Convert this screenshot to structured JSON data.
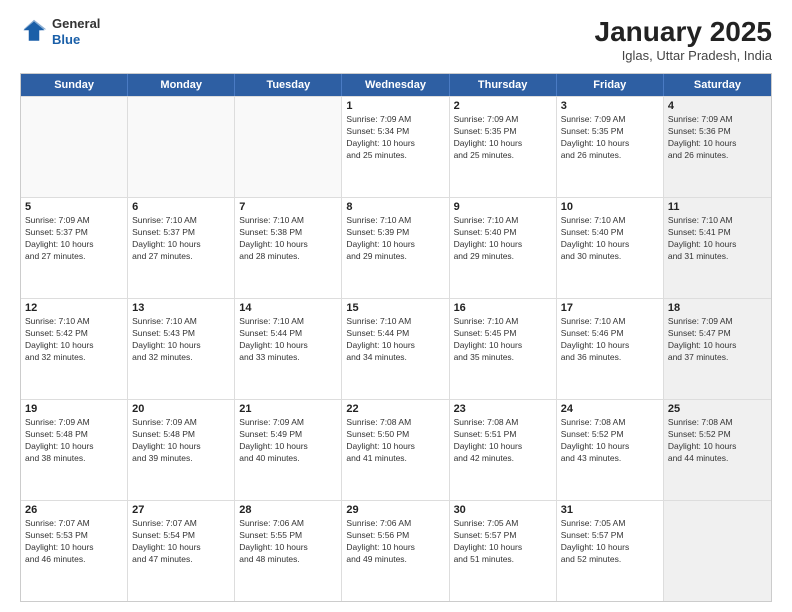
{
  "logo": {
    "general": "General",
    "blue": "Blue"
  },
  "title": "January 2025",
  "subtitle": "Iglas, Uttar Pradesh, India",
  "header_days": [
    "Sunday",
    "Monday",
    "Tuesday",
    "Wednesday",
    "Thursday",
    "Friday",
    "Saturday"
  ],
  "weeks": [
    [
      {
        "day": "",
        "info": "",
        "empty": true
      },
      {
        "day": "",
        "info": "",
        "empty": true
      },
      {
        "day": "",
        "info": "",
        "empty": true
      },
      {
        "day": "1",
        "info": "Sunrise: 7:09 AM\nSunset: 5:34 PM\nDaylight: 10 hours\nand 25 minutes."
      },
      {
        "day": "2",
        "info": "Sunrise: 7:09 AM\nSunset: 5:35 PM\nDaylight: 10 hours\nand 25 minutes."
      },
      {
        "day": "3",
        "info": "Sunrise: 7:09 AM\nSunset: 5:35 PM\nDaylight: 10 hours\nand 26 minutes."
      },
      {
        "day": "4",
        "info": "Sunrise: 7:09 AM\nSunset: 5:36 PM\nDaylight: 10 hours\nand 26 minutes.",
        "shaded": true
      }
    ],
    [
      {
        "day": "5",
        "info": "Sunrise: 7:09 AM\nSunset: 5:37 PM\nDaylight: 10 hours\nand 27 minutes."
      },
      {
        "day": "6",
        "info": "Sunrise: 7:10 AM\nSunset: 5:37 PM\nDaylight: 10 hours\nand 27 minutes."
      },
      {
        "day": "7",
        "info": "Sunrise: 7:10 AM\nSunset: 5:38 PM\nDaylight: 10 hours\nand 28 minutes."
      },
      {
        "day": "8",
        "info": "Sunrise: 7:10 AM\nSunset: 5:39 PM\nDaylight: 10 hours\nand 29 minutes."
      },
      {
        "day": "9",
        "info": "Sunrise: 7:10 AM\nSunset: 5:40 PM\nDaylight: 10 hours\nand 29 minutes."
      },
      {
        "day": "10",
        "info": "Sunrise: 7:10 AM\nSunset: 5:40 PM\nDaylight: 10 hours\nand 30 minutes."
      },
      {
        "day": "11",
        "info": "Sunrise: 7:10 AM\nSunset: 5:41 PM\nDaylight: 10 hours\nand 31 minutes.",
        "shaded": true
      }
    ],
    [
      {
        "day": "12",
        "info": "Sunrise: 7:10 AM\nSunset: 5:42 PM\nDaylight: 10 hours\nand 32 minutes."
      },
      {
        "day": "13",
        "info": "Sunrise: 7:10 AM\nSunset: 5:43 PM\nDaylight: 10 hours\nand 32 minutes."
      },
      {
        "day": "14",
        "info": "Sunrise: 7:10 AM\nSunset: 5:44 PM\nDaylight: 10 hours\nand 33 minutes."
      },
      {
        "day": "15",
        "info": "Sunrise: 7:10 AM\nSunset: 5:44 PM\nDaylight: 10 hours\nand 34 minutes."
      },
      {
        "day": "16",
        "info": "Sunrise: 7:10 AM\nSunset: 5:45 PM\nDaylight: 10 hours\nand 35 minutes."
      },
      {
        "day": "17",
        "info": "Sunrise: 7:10 AM\nSunset: 5:46 PM\nDaylight: 10 hours\nand 36 minutes."
      },
      {
        "day": "18",
        "info": "Sunrise: 7:09 AM\nSunset: 5:47 PM\nDaylight: 10 hours\nand 37 minutes.",
        "shaded": true
      }
    ],
    [
      {
        "day": "19",
        "info": "Sunrise: 7:09 AM\nSunset: 5:48 PM\nDaylight: 10 hours\nand 38 minutes."
      },
      {
        "day": "20",
        "info": "Sunrise: 7:09 AM\nSunset: 5:48 PM\nDaylight: 10 hours\nand 39 minutes."
      },
      {
        "day": "21",
        "info": "Sunrise: 7:09 AM\nSunset: 5:49 PM\nDaylight: 10 hours\nand 40 minutes."
      },
      {
        "day": "22",
        "info": "Sunrise: 7:08 AM\nSunset: 5:50 PM\nDaylight: 10 hours\nand 41 minutes."
      },
      {
        "day": "23",
        "info": "Sunrise: 7:08 AM\nSunset: 5:51 PM\nDaylight: 10 hours\nand 42 minutes."
      },
      {
        "day": "24",
        "info": "Sunrise: 7:08 AM\nSunset: 5:52 PM\nDaylight: 10 hours\nand 43 minutes."
      },
      {
        "day": "25",
        "info": "Sunrise: 7:08 AM\nSunset: 5:52 PM\nDaylight: 10 hours\nand 44 minutes.",
        "shaded": true
      }
    ],
    [
      {
        "day": "26",
        "info": "Sunrise: 7:07 AM\nSunset: 5:53 PM\nDaylight: 10 hours\nand 46 minutes."
      },
      {
        "day": "27",
        "info": "Sunrise: 7:07 AM\nSunset: 5:54 PM\nDaylight: 10 hours\nand 47 minutes."
      },
      {
        "day": "28",
        "info": "Sunrise: 7:06 AM\nSunset: 5:55 PM\nDaylight: 10 hours\nand 48 minutes."
      },
      {
        "day": "29",
        "info": "Sunrise: 7:06 AM\nSunset: 5:56 PM\nDaylight: 10 hours\nand 49 minutes."
      },
      {
        "day": "30",
        "info": "Sunrise: 7:05 AM\nSunset: 5:57 PM\nDaylight: 10 hours\nand 51 minutes."
      },
      {
        "day": "31",
        "info": "Sunrise: 7:05 AM\nSunset: 5:57 PM\nDaylight: 10 hours\nand 52 minutes."
      },
      {
        "day": "",
        "info": "",
        "empty": true,
        "shaded": true
      }
    ]
  ]
}
